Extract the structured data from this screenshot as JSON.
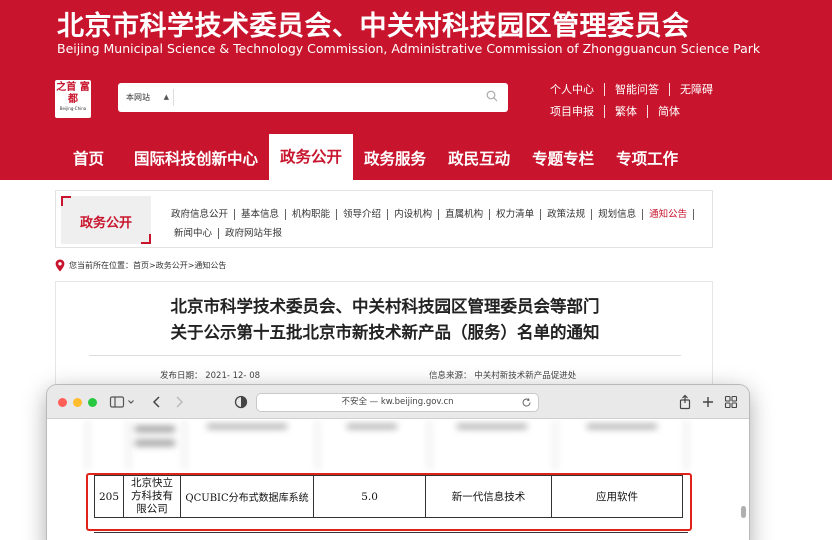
{
  "header": {
    "title_cn": "北京市科学技术委员会、中关村科技园区管理委员会",
    "title_en": "Beijing Municipal Science & Technology Commission, Administrative Commission of Zhongguancun Science Park",
    "brand_color": "#c8152d",
    "logo": {
      "glyphs": "之首 富都",
      "sub": "Beijing-China"
    },
    "search": {
      "scope": "本网站",
      "placeholder": "",
      "icon": "search-icon"
    },
    "links_row1": [
      "个人中心",
      "智能问答",
      "无障碍"
    ],
    "links_row2": [
      "项目申报",
      "繁体",
      "简体"
    ]
  },
  "nav": {
    "items": [
      "首页",
      "国际科技创新中心",
      "政务公开",
      "政务服务",
      "政民互动",
      "专题专栏",
      "专项工作"
    ],
    "active": "政务公开"
  },
  "subnav": {
    "title": "政务公开",
    "items": [
      "政府信息公开",
      "基本信息",
      "机构职能",
      "领导介绍",
      "内设机构",
      "直属机构",
      "权力清单",
      "政策法规",
      "规划信息",
      "通知公告",
      "新闻中心",
      "政府网站年报"
    ],
    "active": "通知公告"
  },
  "breadcrumb": "您当前所在位置：首页>政务公开>通知公告",
  "article": {
    "title_line1": "北京市科学技术委员会、中关村科技园区管理委员会等部门",
    "title_line2": "关于公示第十五批北京市新技术新产品（服务）名单的通知",
    "date_label": "发布日期：",
    "date": "2021- 12- 08",
    "source_label": "信息来源：",
    "source": "中关村新技术新产品促进处"
  },
  "browser": {
    "url": "不安全 — kw.beijing.gov.cn",
    "row": {
      "no": "205",
      "company": "北京快立方科技有限公司",
      "product": "QCUBIC分布式数据库系统",
      "version": "5.0",
      "field": "新一代信息技术",
      "category": "应用软件"
    },
    "highlight_color": "#e0221a"
  }
}
